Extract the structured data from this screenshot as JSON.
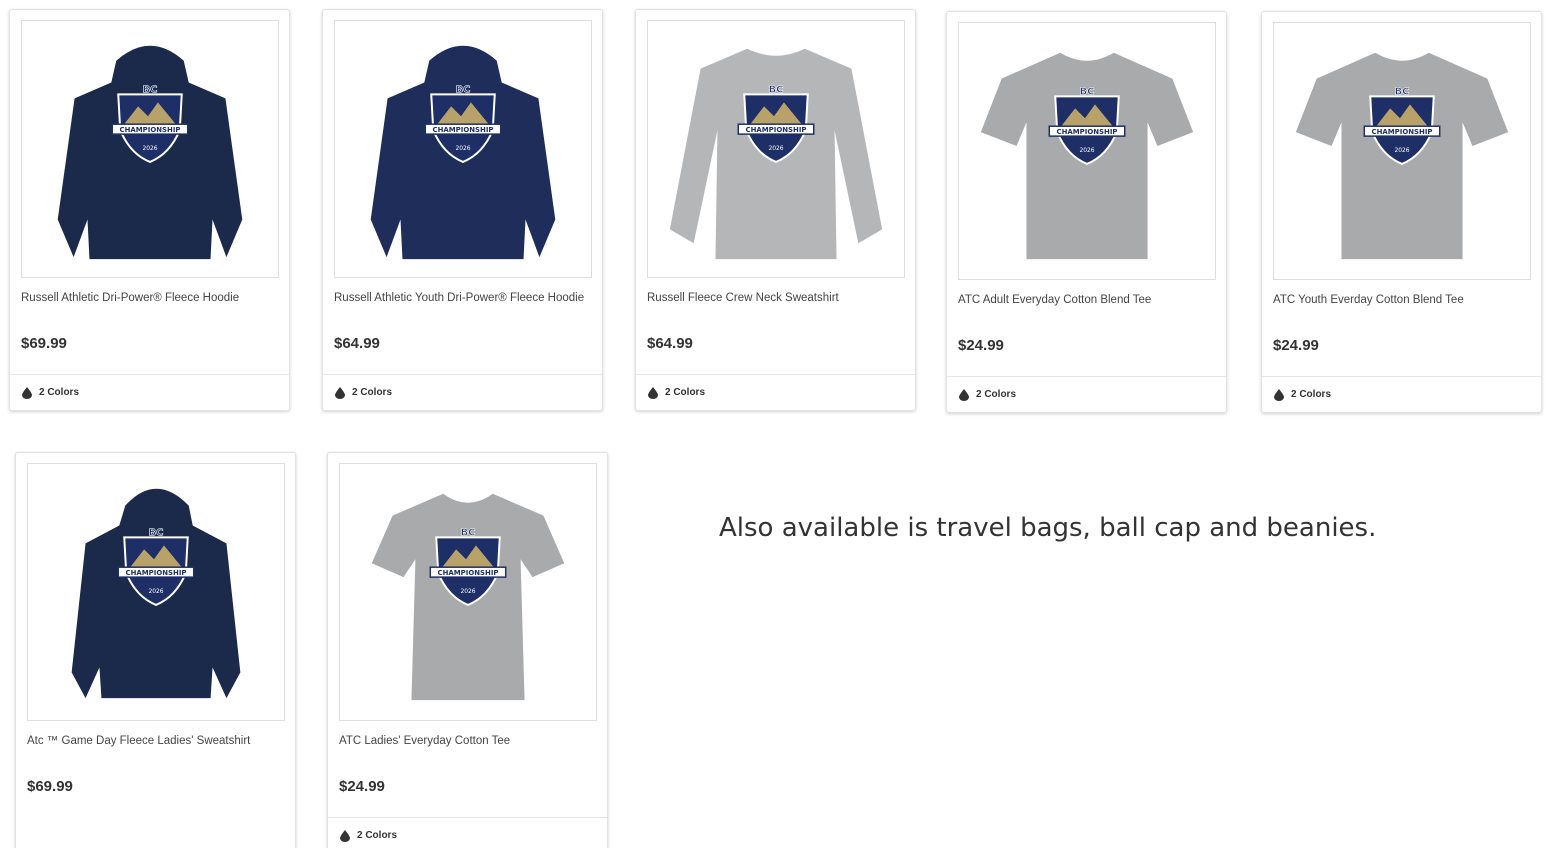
{
  "products": [
    {
      "title": "Russell Athletic Dri-Power® Fleece Hoodie",
      "price": "$69.99",
      "colors": "2 Colors",
      "garment": "hoodie",
      "garment_color": "#1b2a4a"
    },
    {
      "title": "Russell Athletic Youth Dri-Power® Fleece Hoodie",
      "price": "$64.99",
      "colors": "2 Colors",
      "garment": "hoodie",
      "garment_color": "#1e2d5a"
    },
    {
      "title": "Russell Fleece Crew Neck Sweatshirt",
      "price": "$64.99",
      "colors": "2 Colors",
      "garment": "crewneck",
      "garment_color": "#b5b6b8"
    },
    {
      "title": "ATC Adult Everyday Cotton Blend Tee",
      "price": "$24.99",
      "colors": "2 Colors",
      "garment": "tee",
      "garment_color": "#a9aaac"
    },
    {
      "title": "ATC Youth Everday Cotton Blend Tee",
      "price": "$24.99",
      "colors": "2 Colors",
      "garment": "tee",
      "garment_color": "#a9aaac"
    },
    {
      "title": "Atc ™ Game Day Fleece Ladies' Sweatshirt",
      "price": "$69.99",
      "colors": "",
      "garment": "ladies-hoodie",
      "garment_color": "#1b2a4a"
    },
    {
      "title": "ATC Ladies' Everyday Cotton Tee",
      "price": "$24.99",
      "colors": "2 Colors",
      "garment": "ladies-tee",
      "garment_color": "#a9aaac"
    }
  ],
  "logo_text": {
    "brand": "BC",
    "banner": "CHAMPIONSHIP",
    "year": "2026"
  },
  "note": "Also available is travel bags, ball cap and beanies.",
  "icons": {
    "colors_icon": "droplet-icon"
  },
  "theme": {
    "navy": "#1b2a4a",
    "grey": "#a9aaac",
    "logo_navy": "#1d2f66",
    "logo_gold": "#b9a26a"
  }
}
